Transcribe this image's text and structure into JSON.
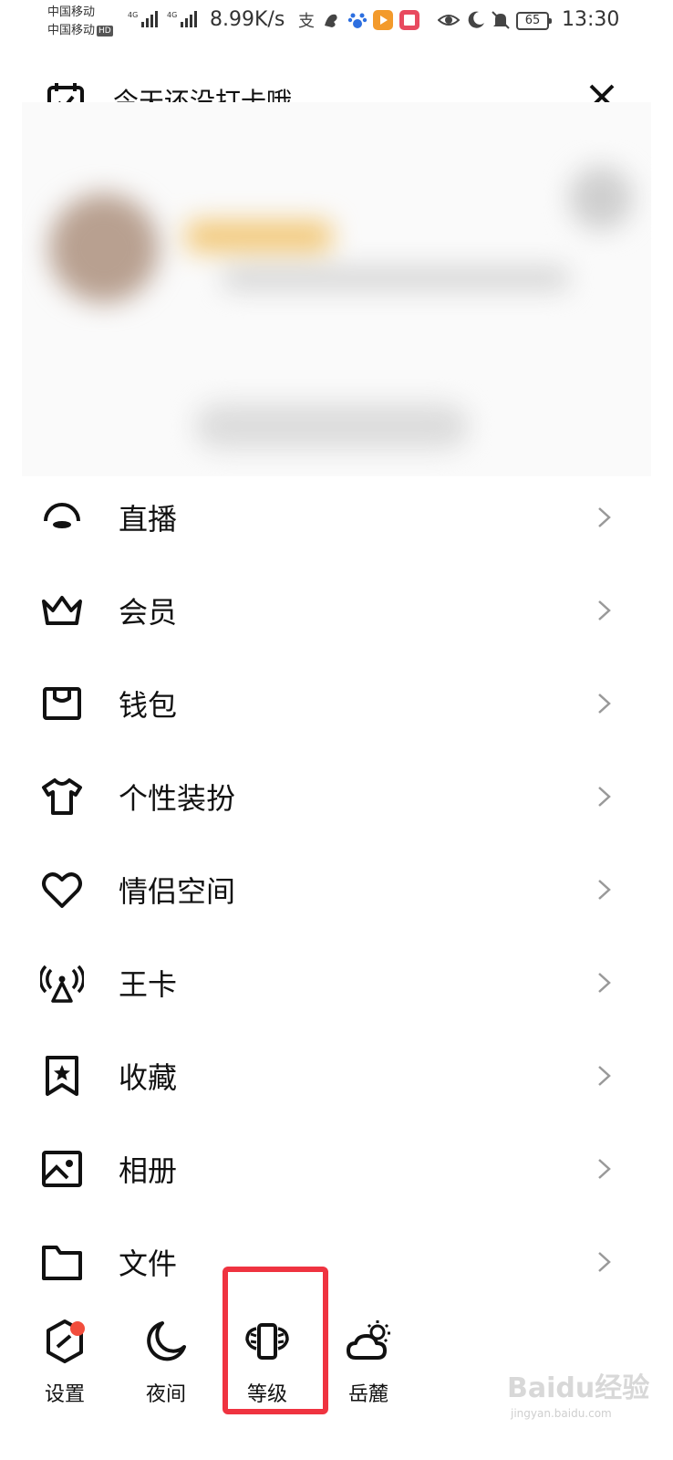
{
  "status_bar": {
    "carrier1": "中国移动",
    "carrier2": "中国移动",
    "hd": "HD",
    "net_type1": "4G",
    "net_type2": "4G",
    "net_speed": "8.99K/s",
    "battery": "65",
    "time": "13:30",
    "icons": [
      "alipay-icon",
      "app-icon",
      "baidu-paw-icon",
      "video-app-icon",
      "book-app-icon",
      "eye-icon",
      "moon-icon",
      "bell-off-icon"
    ]
  },
  "header": {
    "checkin_text": "今天还没打卡哦",
    "close_icon": "close-icon"
  },
  "menu": [
    {
      "label": "直播",
      "icon": "live-icon"
    },
    {
      "label": "会员",
      "icon": "crown-icon"
    },
    {
      "label": "钱包",
      "icon": "wallet-icon"
    },
    {
      "label": "个性装扮",
      "icon": "tshirt-icon"
    },
    {
      "label": "情侣空间",
      "icon": "heart-icon"
    },
    {
      "label": "王卡",
      "icon": "antenna-icon"
    },
    {
      "label": "收藏",
      "icon": "bookmark-star-icon"
    },
    {
      "label": "相册",
      "icon": "photo-icon"
    },
    {
      "label": "文件",
      "icon": "folder-icon"
    }
  ],
  "bottom_bar": [
    {
      "label": "设置",
      "icon": "settings-icon"
    },
    {
      "label": "夜间",
      "icon": "moon-icon"
    },
    {
      "label": "等级",
      "icon": "level-wings-icon"
    },
    {
      "label": "岳麓",
      "icon": "weather-cloud-sun-icon"
    }
  ],
  "colors": {
    "highlight": "#ef3340",
    "red_dot": "#f24d3c"
  },
  "watermark": {
    "brand": "Baidu经验",
    "url": "jingyan.baidu.com"
  }
}
